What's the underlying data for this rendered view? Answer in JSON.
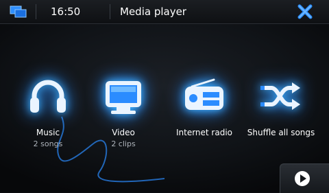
{
  "status_bar": {
    "time": "16:50",
    "title": "Media player"
  },
  "icons": {
    "switcher": "task-switcher-icon",
    "close": "close-icon",
    "music": "headphones-icon",
    "video": "monitor-icon",
    "radio": "radio-icon",
    "shuffle": "shuffle-icon",
    "play": "play-icon"
  },
  "colors": {
    "accent": "#2b8cff",
    "glow": "#3fb3ff",
    "subtext": "#aeb4bb"
  },
  "apps": [
    {
      "label": "Music",
      "sub": "2 songs"
    },
    {
      "label": "Video",
      "sub": "2 clips"
    },
    {
      "label": "Internet radio",
      "sub": ""
    },
    {
      "label": "Shuffle all songs",
      "sub": ""
    }
  ]
}
